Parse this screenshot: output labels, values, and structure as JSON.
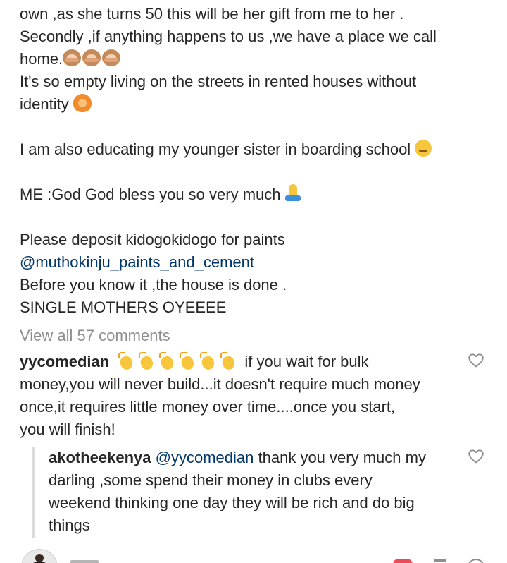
{
  "caption": {
    "line0": "own ,as she turns 50 this will be her gift from me to her .",
    "line1": "Secondly ,if anything happens to us ,we have a place we call",
    "line2": "home.",
    "line3": "It's so empty living on the streets in rented houses without",
    "line4": "identity",
    "line5": "I am also educating my younger sister in boarding school",
    "line6": "ME :God God bless you so very much",
    "line7": "Please deposit kidogokidogo for paints",
    "line8_mention": "@muthokinju_paints_and_cement",
    "line9": "Before you know it ,the house is done .",
    "line10": "SINGLE MOTHERS OYEEEE"
  },
  "view_all": "View all 57 comments",
  "comment": {
    "username": "yycomedian",
    "line1_tail": "if you wait for  bulk",
    "line2": "money,you will never build...it doesn't require much money",
    "line3": "once,it requires little money over time....once you start,",
    "line4": "you will finish!"
  },
  "reply": {
    "username": "akotheekenya",
    "mention": "@yycomedian",
    "line1_tail": "thank you very much my",
    "line2": "darling ,some spend their money  in clubs every",
    "line3": "weekend thinking one day they will be rich and do big",
    "line4": "things"
  },
  "icons": {
    "like": "heart-outline-icon",
    "see_no_evil": "see-no-evil-monkey-emoji",
    "gesture": "person-gesturing-emoji",
    "thinking": "thinking-face-emoji",
    "pray": "folded-hands-emoji",
    "clap": "clapping-hands-emoji"
  },
  "colors": {
    "text": "#262626",
    "mention": "#00376b",
    "muted": "#8e8e8e",
    "reply_bar": "#dbdbdb"
  }
}
